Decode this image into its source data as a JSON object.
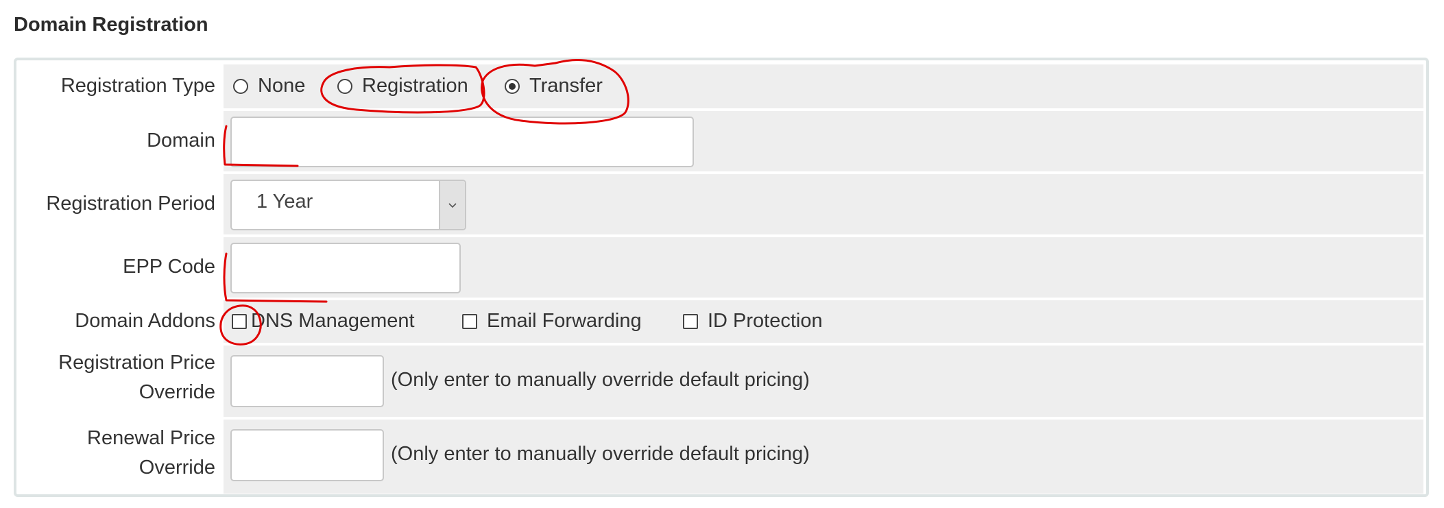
{
  "section": {
    "title": "Domain Registration"
  },
  "form": {
    "registration_type": {
      "label": "Registration Type",
      "options": [
        {
          "label": "None",
          "checked": false
        },
        {
          "label": "Registration",
          "checked": false
        },
        {
          "label": "Transfer",
          "checked": true
        }
      ]
    },
    "domain": {
      "label": "Domain",
      "value": "",
      "placeholder": ""
    },
    "registration_period": {
      "label": "Registration Period",
      "selected": "1 Year"
    },
    "epp_code": {
      "label": "EPP Code",
      "value": ""
    },
    "domain_addons": {
      "label": "Domain Addons",
      "options": [
        {
          "label": "DNS Management",
          "checked": false
        },
        {
          "label": "Email Forwarding",
          "checked": false
        },
        {
          "label": "ID Protection",
          "checked": false
        }
      ]
    },
    "registration_price_override": {
      "label_line1": "Registration Price",
      "label_line2": "Override",
      "value": "",
      "hint": "(Only enter to manually override default pricing)"
    },
    "renewal_price_override": {
      "label_line1": "Renewal Price",
      "label_line2": "Override",
      "value": "",
      "hint": "(Only enter to manually override default pricing)"
    }
  },
  "annotation_color": "#e00000",
  "icons": {
    "select_arrow": "chevron-down-icon"
  }
}
